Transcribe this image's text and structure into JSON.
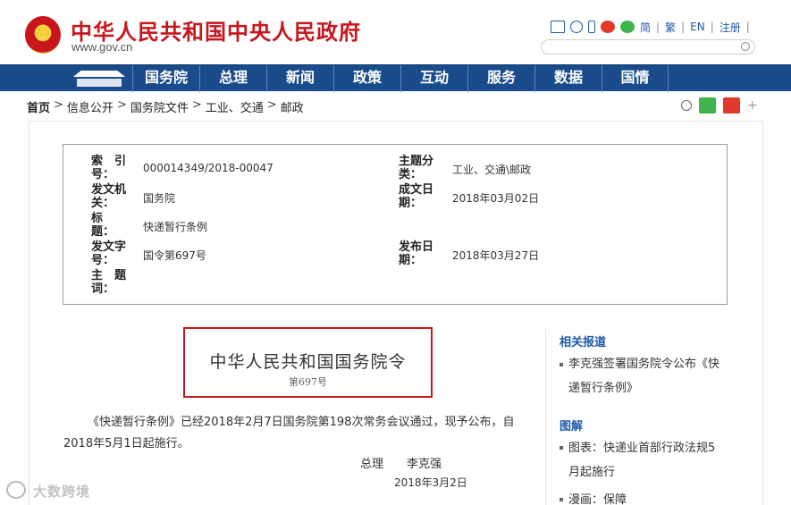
{
  "header": {
    "site_name": "中华人民共和国中央人民政府",
    "site_url": "www.gov.cn",
    "lang_simplified": "简",
    "lang_traditional": "繁",
    "lang_en": "EN",
    "register": "注册",
    "sep": "|"
  },
  "nav": {
    "items": [
      "国务院",
      "总理",
      "新闻",
      "政策",
      "互动",
      "服务",
      "数据",
      "国情"
    ]
  },
  "breadcrumb": {
    "home": "首页",
    "items": [
      "信息公开",
      "国务院文件",
      "工业、交通",
      "邮政"
    ],
    "arrow": ">"
  },
  "info": {
    "index_label_1": "索　引",
    "index_label_2": "号：",
    "index_value": "000014349/2018-00047",
    "category_label_1": "主题分",
    "category_label_2": "类：",
    "category_value": "工业、交通\\邮政",
    "issuer_label_1": "发文机",
    "issuer_label_2": "关：",
    "issuer_value": "国务院",
    "created_label_1": "成文日",
    "created_label_2": "期：",
    "created_value": "2018年03月02日",
    "title_label_1": "标　",
    "title_label_2": "题：",
    "title_value": "快递暂行条例",
    "docno_label_1": "发文字",
    "docno_label_2": "号：",
    "docno_value": "国令第697号",
    "published_label_1": "发布日",
    "published_label_2": "期：",
    "published_value": "2018年03月27日",
    "keyword_label_1": "主　题",
    "keyword_label_2": "词："
  },
  "decree": {
    "title": "中华人民共和国国务院令",
    "number": "第697号"
  },
  "article": {
    "body": "《快递暂行条例》已经2018年2月7日国务院第198次常务会议通过，现予公布，自2018年5月1日起施行。",
    "sign_title": "总理",
    "sign_name": "李克强",
    "date": "2018年3月2日"
  },
  "sidebar": {
    "related_heading": "相关报道",
    "related_item_1": "李克强签署国务院令公布《快",
    "related_item_2": "递暂行条例》",
    "graphic_heading": "图解",
    "graphic_item_1": "图表：快递业首部行政法规5",
    "graphic_item_2": "月起施行",
    "graphic_item_3": "漫画：保障"
  },
  "watermark": {
    "text": "大数跨境"
  },
  "colors": {
    "brand_red": "#c8161d",
    "nav_blue": "#1a4c8b",
    "link_blue": "#1e5aa8"
  }
}
